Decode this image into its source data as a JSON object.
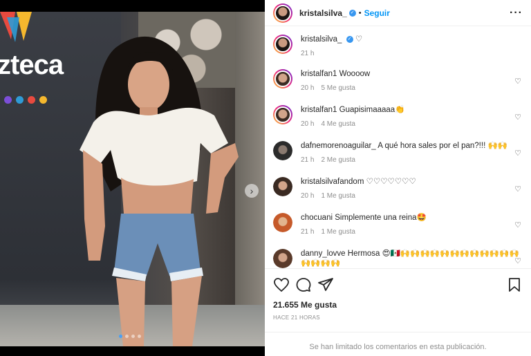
{
  "post": {
    "username": "kristalsilva_",
    "separator": "•",
    "follow_label": "Seguir",
    "more_icon": "more-horizontal-icon",
    "caption": "♡",
    "caption_time": "21 h",
    "carousel": {
      "total": 4,
      "current": 1
    },
    "brand_logo_text": "zteca"
  },
  "comments": [
    {
      "user": "kristalfan1",
      "text": "Woooow",
      "time": "20 h",
      "likes": "5 Me gusta"
    },
    {
      "user": "kristalfan1",
      "text": "Guapisimaaaaa👏",
      "time": "20 h",
      "likes": "4 Me gusta"
    },
    {
      "user": "dafnemorenoaguilar_",
      "text": "A qué hora sales por el pan?!!! 🙌🙌",
      "time": "21 h",
      "likes": "2 Me gusta"
    },
    {
      "user": "kristalsilvafandom",
      "text": "♡♡♡♡♡♡♡",
      "time": "20 h",
      "likes": "1 Me gusta"
    },
    {
      "user": "chocuani",
      "text": "Simplemente una reina🤩",
      "time": "21 h",
      "likes": "1 Me gusta"
    },
    {
      "user": "danny_lovve",
      "text": "Hermosa 😍🇲🇽🙌🙌🙌🙌🙌🙌🙌🙌🙌🙌🙌🙌🙌🙌🙌🙌",
      "time": "",
      "likes": ""
    }
  ],
  "footer": {
    "likes": "21.655 Me gusta",
    "posted": "HACE 21 HORAS",
    "limited_text": "Se han limitado los comentarios en esta publicación."
  },
  "colors": {
    "accent": "#0095f6",
    "verified": "#3897f0",
    "meta": "#8e8e8e"
  }
}
